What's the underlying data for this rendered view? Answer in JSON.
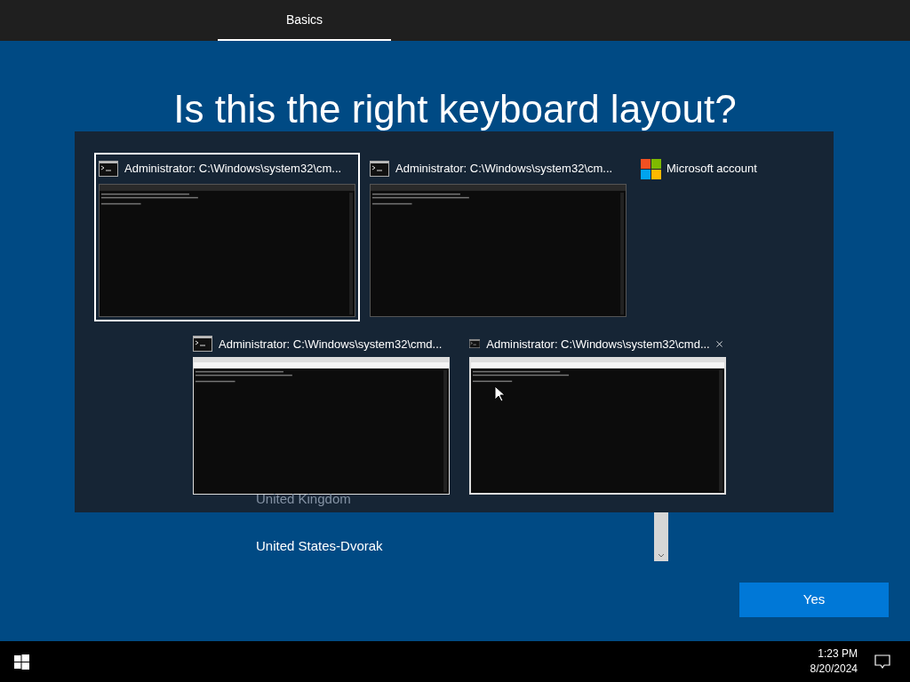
{
  "header": {
    "tabs": [
      {
        "label": "Basics",
        "selected": true
      }
    ]
  },
  "page": {
    "title": "Is this the right keyboard layout?",
    "layouts": [
      {
        "label": "United Kingdom",
        "selected": false
      },
      {
        "label": "United States-Dvorak",
        "selected": false
      }
    ],
    "primary_button": "Yes"
  },
  "task_view": {
    "rows": [
      [
        {
          "kind": "window",
          "title": "Administrator: C:\\Windows\\system32\\cm...",
          "selected": true,
          "close_shown": false,
          "light_titlebar": false
        },
        {
          "kind": "window",
          "title": "Administrator: C:\\Windows\\system32\\cm...",
          "selected": false,
          "close_shown": false,
          "light_titlebar": false
        },
        {
          "kind": "account",
          "title": "Microsoft account",
          "selected": false
        }
      ],
      [
        {
          "kind": "window",
          "title": "Administrator: C:\\Windows\\system32\\cmd...",
          "selected": false,
          "close_shown": false,
          "light_titlebar": true
        },
        {
          "kind": "window",
          "title": "Administrator: C:\\Windows\\system32\\cmd...",
          "selected": false,
          "close_shown": true,
          "light_titlebar": true
        }
      ]
    ]
  },
  "taskbar": {
    "time": "1:23 PM",
    "date": "8/20/2024"
  }
}
